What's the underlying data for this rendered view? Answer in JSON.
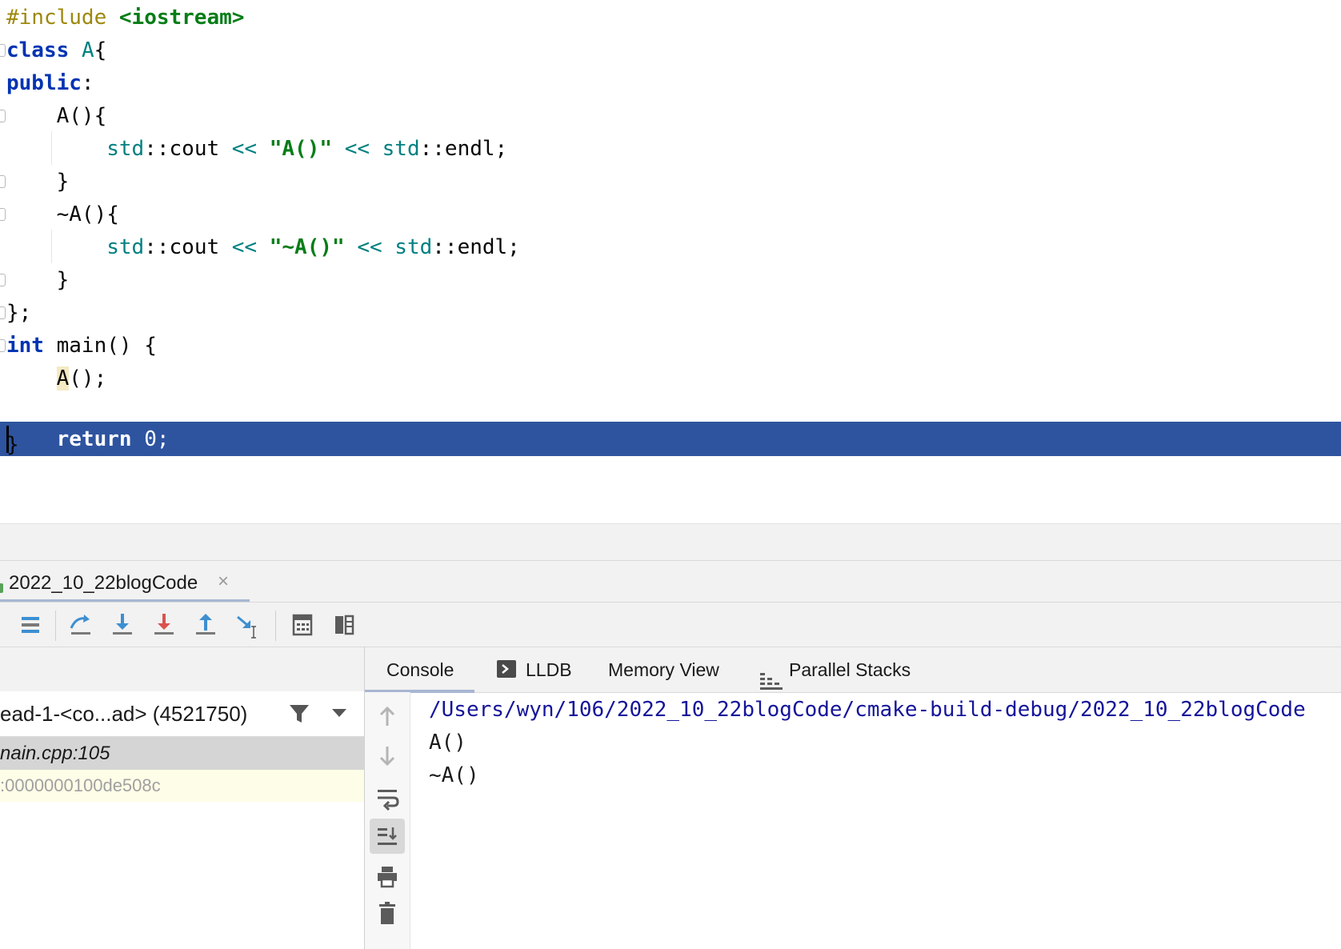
{
  "editor": {
    "lines": {
      "l1_pp": "#include ",
      "l1_hdr": "<iostream>",
      "l2_kw": "class",
      "l2_cls": "A",
      "l2_rest": "{",
      "l3_kw": "public",
      "l3_rest": ":",
      "l4": "    A(){",
      "l5_ns": "std",
      "l5_a": "::cout ",
      "l5_op": "<<",
      "l5_str": "\"A()\"",
      "l5_op2": "<<",
      "l5_ns2": "std",
      "l5_b": "::endl;",
      "l6": "    }",
      "l7": "    ~A(){",
      "l8_ns": "std",
      "l8_a": "::cout ",
      "l8_op": "<<",
      "l8_str": "\"~A()\"",
      "l8_op2": "<<",
      "l8_ns2": "std",
      "l8_b": "::endl;",
      "l9": "    }",
      "l10": "};",
      "l11_kw": "int",
      "l11_rest": " main() {",
      "l12_hl": "A",
      "l12_rest": "();",
      "l13_kw": "return",
      "l13_rest": " 0;",
      "l14": "}"
    },
    "execution_line_color": "#2e54a0"
  },
  "debug_tab": {
    "label": "2022_10_22blogCode",
    "close_icon": "close-icon"
  },
  "toolbar": {
    "icons": [
      "show-execution-point-icon",
      "step-over-icon",
      "step-into-icon",
      "force-step-into-icon",
      "step-out-icon",
      "run-to-cursor-icon",
      "evaluate-expression-icon",
      "layout-icon"
    ]
  },
  "frames": {
    "thread": "ead-1-<co...ad> (4521750)",
    "items": [
      "nain.cpp:105",
      ":0000000100de508c"
    ]
  },
  "console_tabs": {
    "console": "Console",
    "lldb": "LLDB",
    "memory": "Memory View",
    "parallel": "Parallel Stacks"
  },
  "console": {
    "path": "/Users/wyn/106/2022_10_22blogCode/cmake-build-debug/2022_10_22blogCode",
    "out1": "A()",
    "out2": "~A()"
  },
  "colors": {
    "accent_blue": "#3d8fd1",
    "force_step_red": "#d9534f",
    "panel_bg": "#f2f2f2"
  }
}
